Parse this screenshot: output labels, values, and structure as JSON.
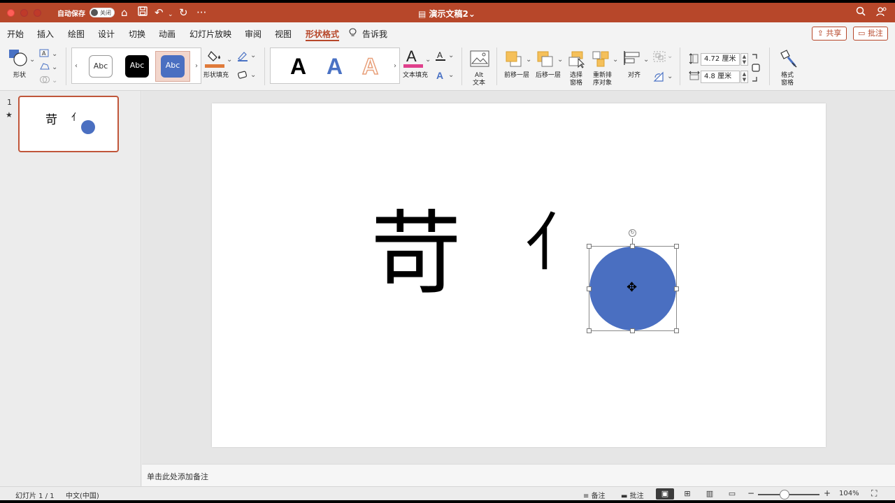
{
  "titlebar": {
    "autosave_label": "自动保存",
    "autosave_state": "关闭",
    "doc_title": "演示文稿2",
    "doc_title_chevron": "⌄"
  },
  "tabs": [
    {
      "label": "开始"
    },
    {
      "label": "插入"
    },
    {
      "label": "绘图"
    },
    {
      "label": "设计"
    },
    {
      "label": "切换"
    },
    {
      "label": "动画"
    },
    {
      "label": "幻灯片放映"
    },
    {
      "label": "审阅"
    },
    {
      "label": "视图"
    },
    {
      "label": "形状格式",
      "active": true
    },
    {
      "label": "告诉我"
    }
  ],
  "actions": {
    "share": "共享",
    "comments": "批注"
  },
  "ribbon": {
    "shapes_label": "形状",
    "style_gallery": [
      "Abc",
      "Abc",
      "Abc"
    ],
    "shape_fill_label": "形状填充",
    "wordart_glyph": "A",
    "text_fill_label": "文本填充",
    "alt_text_line1": "Alt",
    "alt_text_line2": "文本",
    "bring_forward_label": "前移一层",
    "send_backward_label": "后移一层",
    "selection_pane_line1": "选择",
    "selection_pane_line2": "窗格",
    "reorder_line1": "重新排",
    "reorder_line2": "序对象",
    "align_label": "对齐",
    "height_value": "4.72 厘米",
    "width_value": "4.8 厘米",
    "format_pane_line1": "格式",
    "format_pane_line2": "窗格"
  },
  "colors": {
    "accent": "#b7472a",
    "shape_fill": "#4a6fc1",
    "fill_underline": "#e07a3a",
    "text_fill_underline": "#e0408c",
    "wordart_blue": "#4a72c4",
    "wordart_orange": "#e8a07a"
  },
  "thumbnails": {
    "slide_number": "1",
    "star": "★",
    "char1": "苛",
    "char2": "亻"
  },
  "slide": {
    "char_big": "苛",
    "char_small": "亻"
  },
  "notes_placeholder": "单击此处添加备注",
  "status": {
    "slide_count": "幻灯片 1 / 1",
    "language": "中文(中国)",
    "notes_label": "备注",
    "comments_label": "批注",
    "zoom_minus": "−",
    "zoom_plus": "+",
    "zoom_level": "104%",
    "zoom_fraction": 0.43
  }
}
